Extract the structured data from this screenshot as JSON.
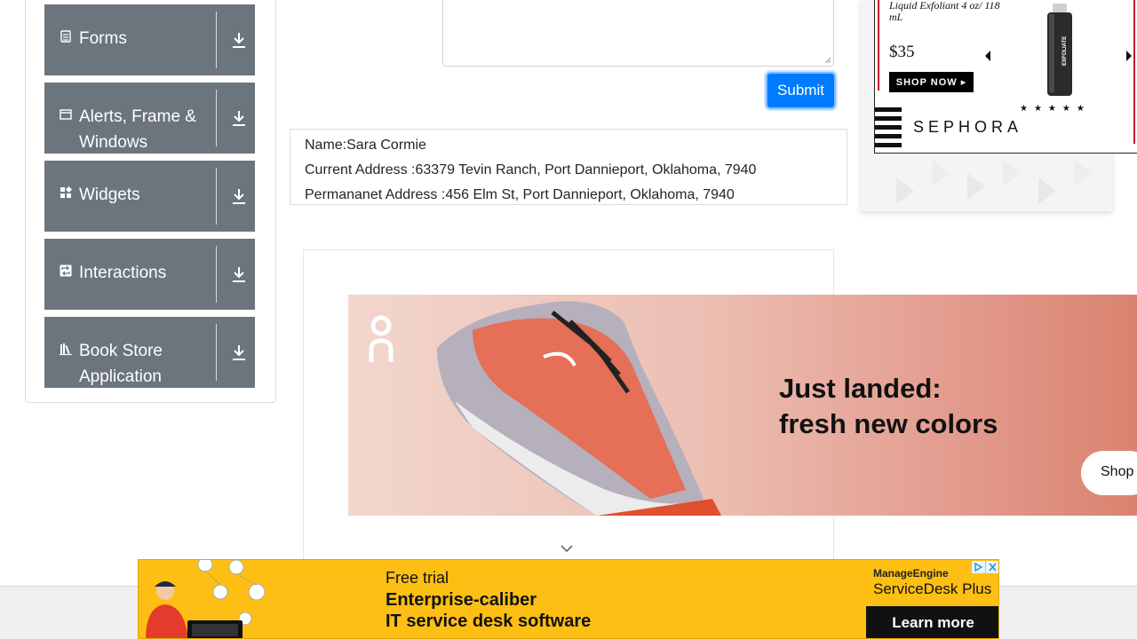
{
  "sidebar": {
    "groups": [
      {
        "label": "Forms",
        "icon": "document-icon"
      },
      {
        "label": "Alerts, Frame &\nWindows",
        "icon": "window-icon"
      },
      {
        "label": "Widgets",
        "icon": "widgets-icon"
      },
      {
        "label": "Interactions",
        "icon": "interactions-icon"
      },
      {
        "label": "Book Store\nApplication",
        "icon": "book-icon"
      }
    ]
  },
  "form": {
    "submit_label": "Submit"
  },
  "output": {
    "name": "Name:Sara Cormie",
    "current_address": "Current Address :63379 Tevin Ranch, Port Dannieport, Oklahoma, 7940",
    "permanent_address": "Permananet Address :456 Elm St, Port Dannieport, Oklahoma, 7940"
  },
  "sephora_ad": {
    "product": "Liquid Exfoliant 4 oz/ 118 mL",
    "price": "$35",
    "shop_now": "SHOP NOW ▸",
    "stars": "★★★★★",
    "brand": "SEPHORA",
    "bottle_label": "EXFOLIATE"
  },
  "on_ad": {
    "headline_line1": "Just landed:",
    "headline_line2": "fresh new colors",
    "shop_label": "Shop"
  },
  "manageengine_ad": {
    "free_trial": "Free trial",
    "line1": "Enterprise-caliber",
    "line2": "IT service desk software",
    "brand": "ManageEngine",
    "product": "ServiceDesk Plus",
    "cta": "Learn more"
  },
  "colors": {
    "sidebar_group_bg": "#6c757d",
    "submit_bg": "#007bff",
    "ad_yellow": "#fdbf13"
  }
}
